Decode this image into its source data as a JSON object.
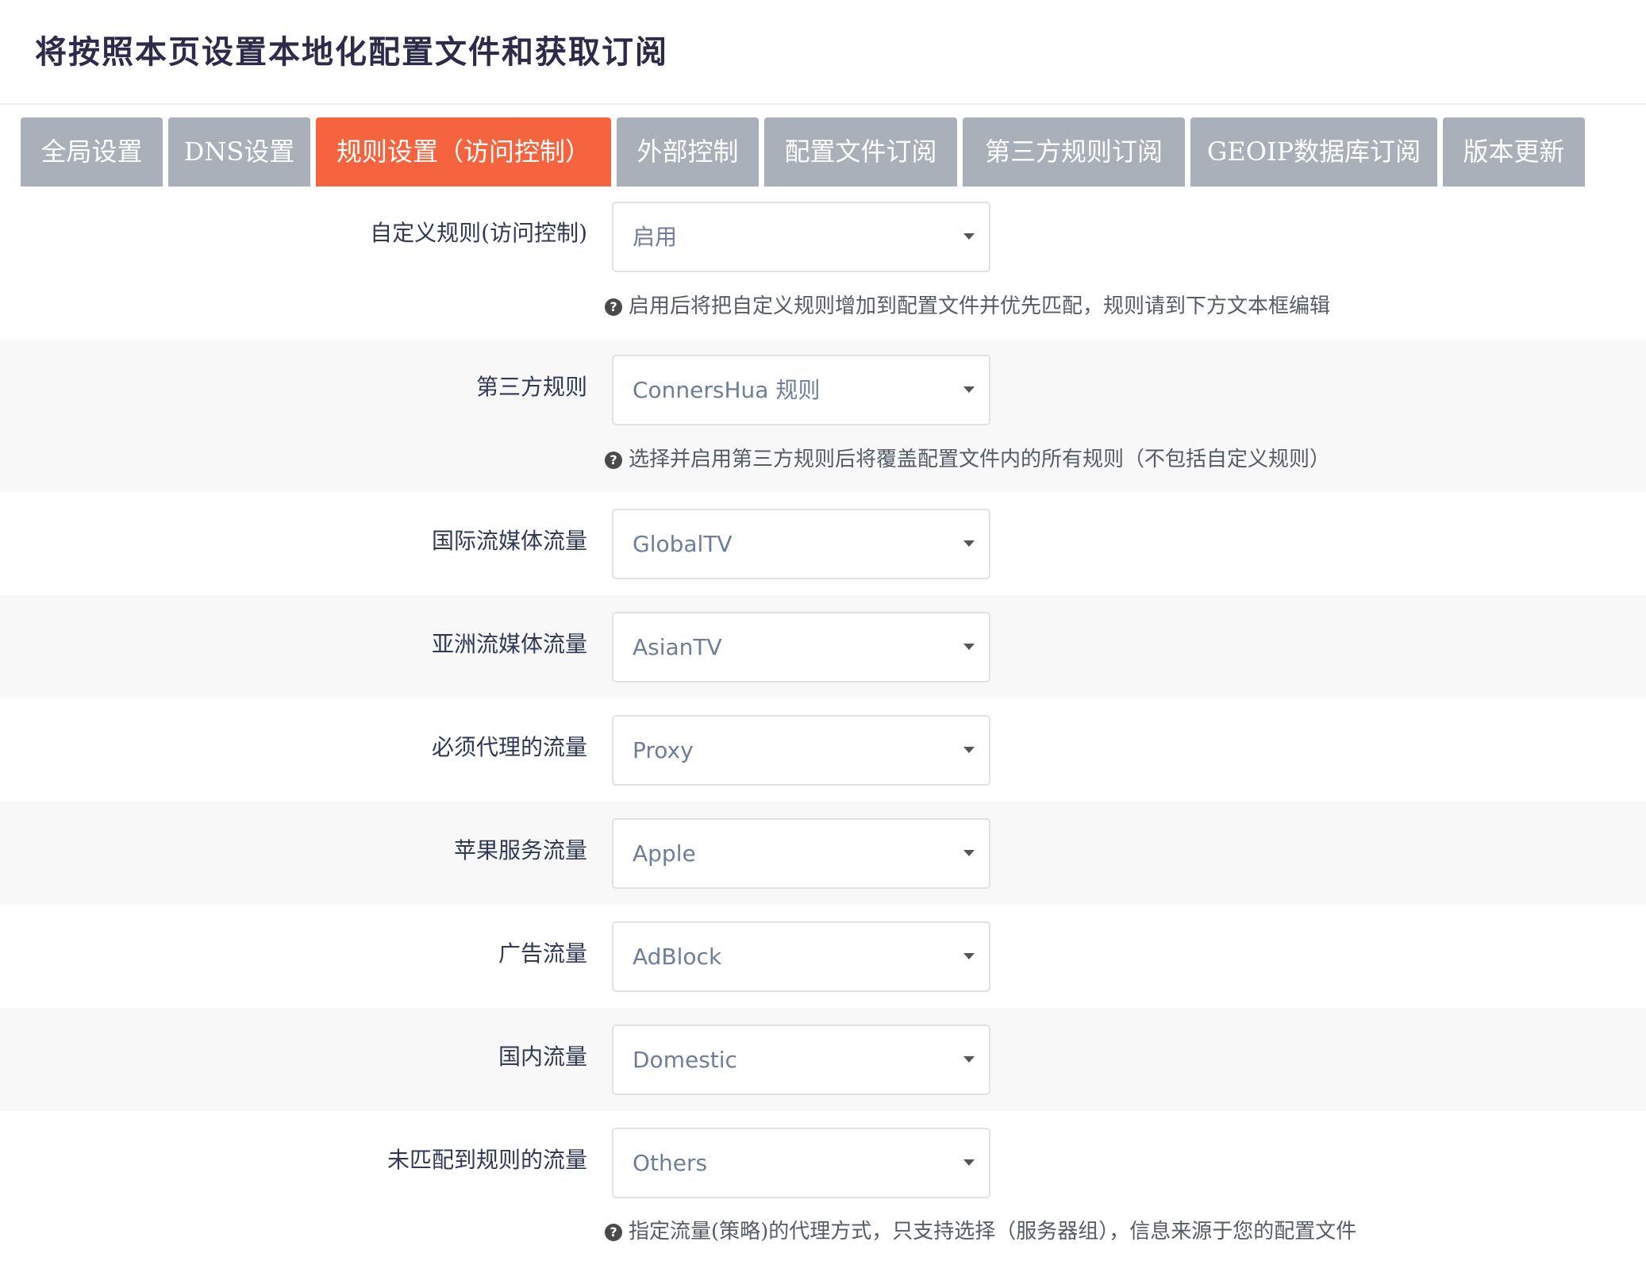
{
  "page": {
    "title": "将按照本页设置本地化配置文件和获取订阅"
  },
  "tabs": [
    {
      "label": "全局设置",
      "active": false
    },
    {
      "label": "DNS设置",
      "active": false
    },
    {
      "label": "规则设置（访问控制）",
      "active": true
    },
    {
      "label": "外部控制",
      "active": false
    },
    {
      "label": "配置文件订阅",
      "active": false
    },
    {
      "label": "第三方规则订阅",
      "active": false
    },
    {
      "label": "GEOIP数据库订阅",
      "active": false
    },
    {
      "label": "版本更新",
      "active": false
    }
  ],
  "fields": [
    {
      "label": "自定义规则(访问控制)",
      "value": "启用",
      "help": "启用后将把自定义规则增加到配置文件并优先匹配，规则请到下方文本框编辑"
    },
    {
      "label": "第三方规则",
      "value": "ConnersHua 规则",
      "help": "选择并启用第三方规则后将覆盖配置文件内的所有规则（不包括自定义规则）"
    },
    {
      "label": "国际流媒体流量",
      "value": "GlobalTV"
    },
    {
      "label": "亚洲流媒体流量",
      "value": "AsianTV"
    },
    {
      "label": "必须代理的流量",
      "value": "Proxy"
    },
    {
      "label": "苹果服务流量",
      "value": "Apple"
    },
    {
      "label": "广告流量",
      "value": "AdBlock"
    },
    {
      "label": "国内流量",
      "value": "Domestic"
    },
    {
      "label": "未匹配到规则的流量",
      "value": "Others",
      "help": "指定流量(策略)的代理方式，只支持选择（服务器组），信息来源于您的配置文件"
    }
  ],
  "icons": {
    "help": "question-circle-icon",
    "dropdown": "caret-down-icon"
  },
  "colors": {
    "tab_active": "#f6643f",
    "tab_inactive": "#a9b0b9",
    "row_shaded": "#f8f8f8",
    "title": "#2c2c4a"
  }
}
